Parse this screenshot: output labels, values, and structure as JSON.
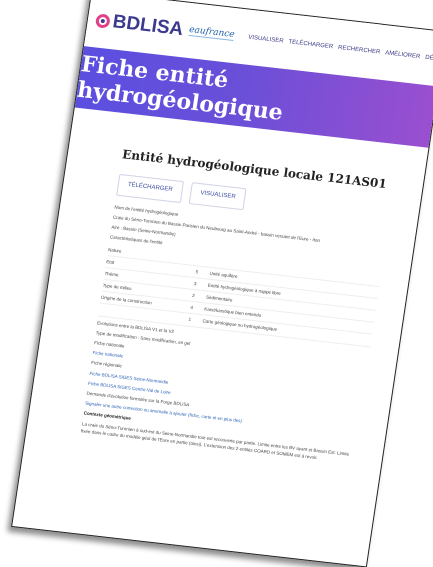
{
  "header": {
    "logo_text": "BDLISA",
    "partner_logo": "eaufrance",
    "nav": [
      "VISUALISER",
      "TÉLÉCHARGER",
      "RECHERCHER",
      "AMÉLIORER",
      "DÉCOUVRIR"
    ]
  },
  "hero": {
    "title": "Fiche entité hydrogéologique"
  },
  "entity": {
    "title": "Entité hydrogéologique locale 121AS01",
    "download_label": "TÉLÉCHARGER",
    "visualize_label": "VISUALISER",
    "name_label": "Nom de l'entité hydrogéologique",
    "name_value": "Craie du Séno-Turonien du Bassin Parisien du Neubourg au Saint-André - bassin versant de l'Eure - Iton",
    "aire_value": "Aire : Bassin (Seine-Normandie)",
    "charac_heading": "Caractéristiques de l'entité",
    "table_header": "Nature",
    "rows": [
      {
        "label": "Etat",
        "code": "5",
        "value": "Unité aquifère"
      },
      {
        "label": "Thème",
        "code": "3",
        "value": "Entité hydrogéologique à nappe libre"
      },
      {
        "label": "Type de milieu",
        "code": "2",
        "value": "Sédimentaire"
      },
      {
        "label": "Origine de la construction",
        "code": "4",
        "value": "Karst/karstique bien entendu"
      },
      {
        "label": "",
        "code": "1",
        "value": "Carte géologique ou hydrogéologique"
      }
    ],
    "evolution": "Evolutions entre la BDLISA V1 et la V2",
    "modif_type": "Type de modification : Sans modification, en gel",
    "nationale_heading": "Fiche nationale",
    "nationale_link": "Fiche nationale",
    "regionale_heading": "Fiche régionale",
    "regionale_links": [
      "Fiche BDLISA SIGES Seine-Normandie",
      "Fiche BDLISA SIGES Centre-Val de Loire"
    ],
    "demande_text": "Demande d'évolution formulée sur la Forge BDLISA",
    "signal_link": "Signaler une autre correction ou anomalie à ajouter (fiche, carte et en plus des)",
    "contexte_heading": "Contexte géométrique",
    "contexte_text": "La craie du Séno-Turonien à sud-est du Seine-Normandie tout est recouverte par partie. Limite entre les BV ayant et Bassin Est. Limite fixée dans le cadre du modèle géol de l'Eure en partie (ainsi). L'extension des 2 entités COARD et SOMEM est à revoir."
  }
}
